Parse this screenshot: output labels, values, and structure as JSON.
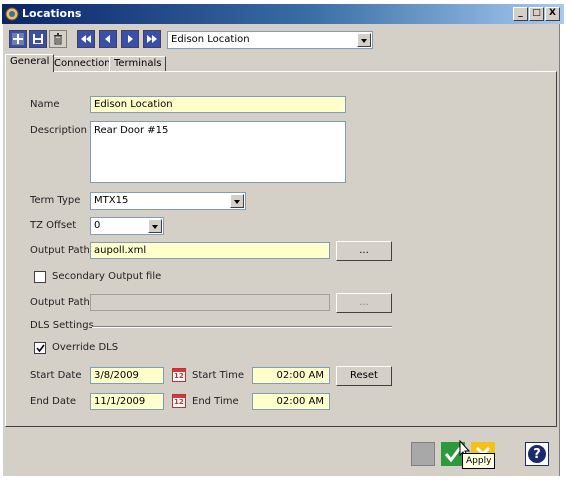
{
  "window": {
    "title": "Locations",
    "controls": {
      "minimize": "_",
      "maximize": "□",
      "close": "X"
    }
  },
  "toolbar": {
    "icons": [
      "add-icon",
      "save-icon",
      "delete-icon",
      "first-record-icon",
      "previous-record-icon",
      "next-record-icon",
      "last-record-icon"
    ],
    "location_selector": "Edison Location"
  },
  "tabs": [
    {
      "label": "General",
      "active": true
    },
    {
      "label": "Connection",
      "active": false
    },
    {
      "label": "Terminals",
      "active": false
    }
  ],
  "general": {
    "name_label": "Name",
    "name_value": "Edison Location",
    "description_label": "Description",
    "description_value": "Rear Door #15",
    "term_type_label": "Term Type",
    "term_type_value": "MTX15",
    "tz_offset_label": "TZ Offset",
    "tz_offset_value": "0",
    "output_path_label": "Output Path",
    "output_path_value": "aupoll.xml",
    "browse_label": "...",
    "secondary_output_label": "Secondary Output file",
    "secondary_output_checked": false,
    "output_path2_label": "Output Path",
    "output_path2_value": "",
    "browse2_label": "...",
    "dls_settings_label": "DLS Settings",
    "override_dls_label": "Override DLS",
    "override_dls_checked": true,
    "start_date_label": "Start Date",
    "start_date_value": "3/8/2009",
    "start_time_label": "Start Time",
    "start_time_value": "02:00 AM",
    "reset_label": "Reset",
    "end_date_label": "End Date",
    "end_date_value": "11/1/2009",
    "end_time_label": "End Time",
    "end_time_value": "02:00 AM",
    "calendar_glyph": "12"
  },
  "bottom": {
    "icons": [
      "blank-icon",
      "apply-icon",
      "cancel-icon",
      "help-icon"
    ],
    "tooltip": "Apply",
    "help_glyph": "?"
  },
  "colors": {
    "title_gradient_start": "#0a246a",
    "highlight_field": "#ffffcc",
    "toolbar_button": "#3a4fa8",
    "apply_green": "#2a9a3a",
    "cancel_yellow": "#f2c21a"
  }
}
